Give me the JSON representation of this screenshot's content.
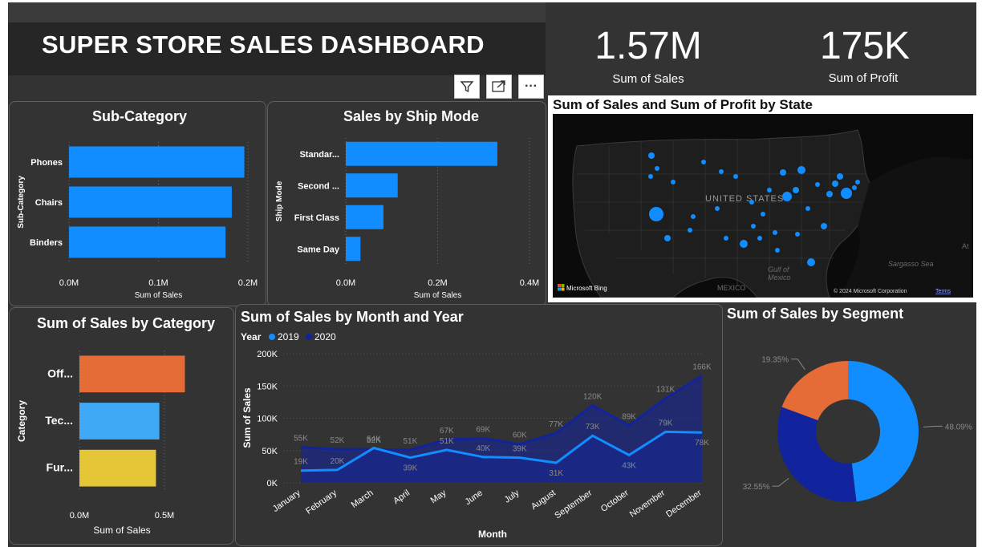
{
  "header": {
    "title": "SUPER STORE SALES DASHBOARD"
  },
  "kpis": [
    {
      "value": "1.57M",
      "label": "Sum of Sales"
    },
    {
      "value": "175K",
      "label": "Sum of Profit"
    }
  ],
  "toolbar": {
    "icons": [
      "filter-icon",
      "focus-mode-icon",
      "more-options-icon"
    ],
    "more_label": "···"
  },
  "colors": {
    "accent_blue": "#118DFF",
    "dark_blue": "#12239E",
    "orange": "#E66C37",
    "light_blue": "#3FA9F5",
    "yellow": "#E5C637"
  },
  "subcategory_chart": {
    "title": "Sub-Category",
    "xlabel": "Sum of Sales",
    "ylabel": "Sub-Category",
    "ticks": [
      "0.0M",
      "0.1M",
      "0.2M"
    ]
  },
  "shipmode_chart": {
    "title": "Sales by Ship Mode",
    "xlabel": "Sum of Sales",
    "ylabel": "Ship Mode",
    "ticks": [
      "0.0M",
      "0.2M",
      "0.4M"
    ]
  },
  "map": {
    "title": "Sum of Sales and Sum of Profit by State",
    "country_label": "UNITED STATES",
    "places": [
      "Gulf of",
      "Mexico",
      "MEXICO",
      "Sargasso Sea",
      "At"
    ],
    "attribution": "Microsoft Bing",
    "copyright": "© 2024 Microsoft Corporation",
    "terms": "Terms"
  },
  "category_chart": {
    "title": "Sum of Sales by Category",
    "xlabel": "Sum of Sales",
    "ylabel": "Category",
    "ticks": [
      "0.0M",
      "0.5M"
    ]
  },
  "month_chart": {
    "title": "Sum of Sales by Month and Year",
    "legend_title": "Year",
    "xlabel": "Month",
    "ylabel": "Sum of Sales",
    "yticks": [
      "200K",
      "150K",
      "100K",
      "50K",
      "0K"
    ]
  },
  "segment_chart": {
    "title": "Sum of Sales by Segment"
  },
  "chart_data": [
    {
      "type": "bar",
      "orientation": "horizontal",
      "title": "Sub-Category",
      "categories": [
        "Phones",
        "Chairs",
        "Binders"
      ],
      "values": [
        0.196,
        0.182,
        0.175
      ],
      "xlabel": "Sum of Sales",
      "ylabel": "Sub-Category",
      "xlim": [
        0,
        0.2
      ],
      "unit": "M"
    },
    {
      "type": "bar",
      "orientation": "horizontal",
      "title": "Sales by Ship Mode",
      "categories": [
        "Standar...",
        "Second ...",
        "First Class",
        "Same Day"
      ],
      "values": [
        0.33,
        0.113,
        0.082,
        0.032
      ],
      "xlabel": "Sum of Sales",
      "ylabel": "Ship Mode",
      "xlim": [
        0,
        0.4
      ],
      "unit": "M"
    },
    {
      "type": "bar",
      "orientation": "horizontal",
      "title": "Sum of Sales by Category",
      "categories": [
        "Off...",
        "Tec...",
        "Fur..."
      ],
      "values": [
        0.62,
        0.47,
        0.45
      ],
      "colors": [
        "#E66C37",
        "#3FA9F5",
        "#E5C637"
      ],
      "xlabel": "Sum of Sales",
      "ylabel": "Category",
      "xlim": [
        0,
        0.5
      ],
      "unit": "M"
    },
    {
      "type": "area",
      "title": "Sum of Sales by Month and Year",
      "x": [
        "January",
        "February",
        "March",
        "April",
        "May",
        "June",
        "July",
        "August",
        "September",
        "October",
        "November",
        "December"
      ],
      "series": [
        {
          "name": "2019",
          "color": "#118DFF",
          "values": [
            19,
            20,
            54,
            39,
            51,
            40,
            39,
            31,
            73,
            43,
            79,
            78
          ],
          "labels": [
            "19K",
            "20K",
            "54K",
            "39K",
            "51K",
            "40K",
            "39K",
            "31K",
            "73K",
            "43K",
            "79K",
            "78K"
          ]
        },
        {
          "name": "2020",
          "color": "#12239E",
          "values": [
            55,
            52,
            52,
            51,
            67,
            69,
            60,
            77,
            120,
            89,
            131,
            166
          ],
          "labels": [
            "55K",
            "52K",
            "52K",
            "51K",
            "67K",
            "69K",
            "60K",
            "77K",
            "120K",
            "89K",
            "131K",
            "166K"
          ]
        }
      ],
      "xlabel": "Month",
      "ylabel": "Sum of Sales",
      "ylim": [
        0,
        200
      ],
      "unit": "K",
      "legend": "top-left"
    },
    {
      "type": "pie",
      "variant": "donut",
      "title": "Sum of Sales by Segment",
      "slices": [
        {
          "value": 48.09,
          "label": "48.09%",
          "color": "#118DFF"
        },
        {
          "value": 32.55,
          "label": "32.55%",
          "color": "#12239E"
        },
        {
          "value": 19.35,
          "label": "19.35%",
          "color": "#E66C37"
        }
      ]
    }
  ]
}
